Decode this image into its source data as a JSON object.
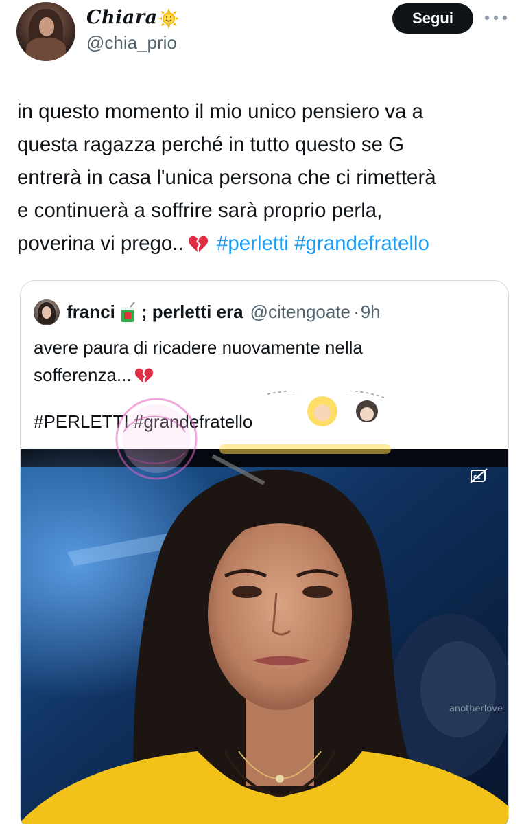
{
  "author": {
    "display_name": "Chiara",
    "name_emoji": "sun-with-face-icon",
    "handle": "@chia_prio"
  },
  "actions": {
    "follow_label": "Segui",
    "more_icon": "more-options-icon"
  },
  "tweet": {
    "lines": [
      "in questo momento il mio unico pensiero va a",
      "questa ragazza perché in tutto questo se G",
      "entrerà in casa l'unica persona che ci rimetterà",
      "e continuerà a soffrire sarà proprio perla,",
      "poverina vi prego.."
    ],
    "line_emoji": "broken-heart-icon",
    "hashtags": [
      "#perletti",
      "#grandefratello"
    ]
  },
  "quoted": {
    "name": "franci",
    "name_emoji": "juice-box-icon",
    "name_suffix": "; perletti era",
    "handle": "@citengoate",
    "separator": "·",
    "time": "9h",
    "text_lines": [
      "avere paura di ricadere nuovamente nella",
      "sofferenza..."
    ],
    "text_emoji": "broken-heart-icon",
    "hashtags_line": "#PERLETTI #grandefratello",
    "media": {
      "description_icon": "closed-captions-off-icon",
      "caption": "anotherlove"
    }
  },
  "colors": {
    "text": "#0f1419",
    "secondary": "#536471",
    "link": "#1d9bf0",
    "border": "#cfd9de",
    "button_bg": "#0f1419",
    "dress": "#f2c21a"
  }
}
